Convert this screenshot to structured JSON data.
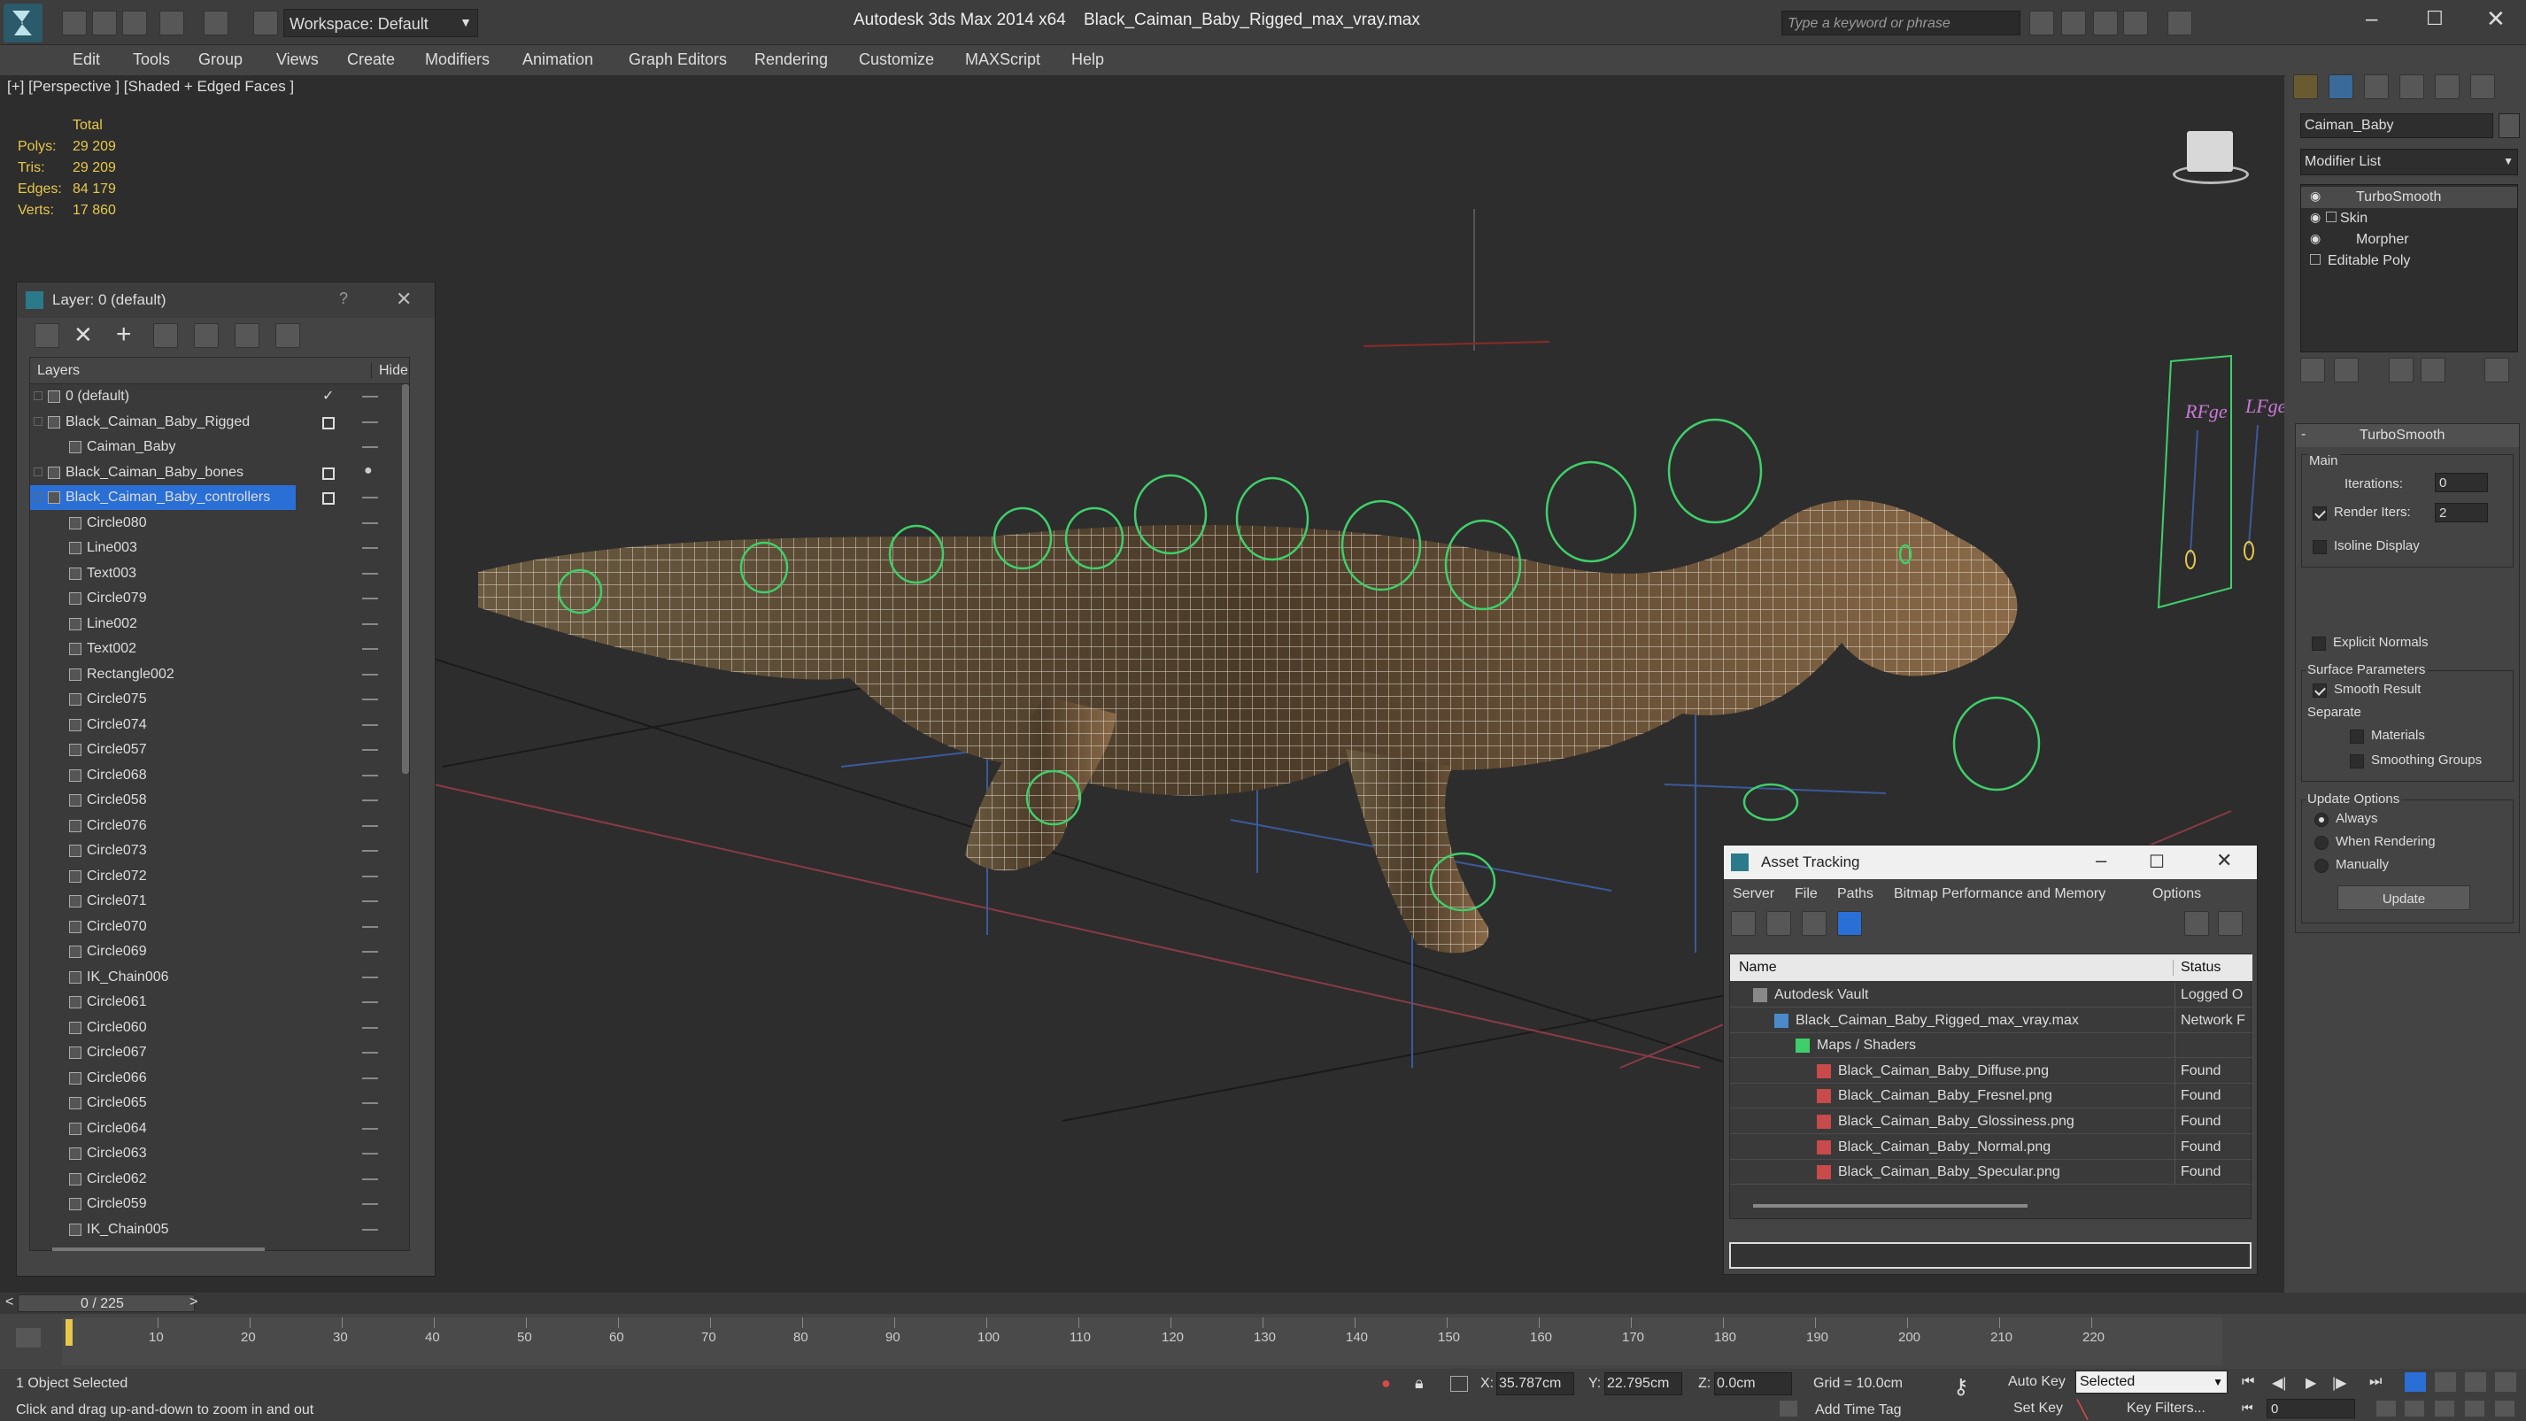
{
  "app": {
    "workspace_label": "Workspace: Default",
    "app_title": "Autodesk 3ds Max  2014 x64",
    "file_title": "Black_Caiman_Baby_Rigged_max_vray.max",
    "search_placeholder": "Type a keyword or phrase"
  },
  "menu": [
    "Edit",
    "Tools",
    "Group",
    "Views",
    "Create",
    "Modifiers",
    "Animation",
    "Graph Editors",
    "Rendering",
    "Customize",
    "MAXScript",
    "Help"
  ],
  "viewport": {
    "label": "[+] [Perspective ] [Shaded + Edged Faces ]",
    "stats": {
      "header": "Total",
      "rows": [
        {
          "label": "Polys:",
          "value": "29 209"
        },
        {
          "label": "Tris:",
          "value": "29 209"
        },
        {
          "label": "Edges:",
          "value": "84 179"
        },
        {
          "label": "Verts:",
          "value": "17 860"
        }
      ]
    },
    "rig_labels": {
      "left": "RFge",
      "right": "LFge"
    }
  },
  "layer_dialog": {
    "title": "Layer: 0 (default)",
    "help": "?",
    "col_layers": "Layers",
    "col_hide": "Hide",
    "rows": [
      {
        "name": "0 (default)",
        "indent": 0,
        "check": true
      },
      {
        "name": "Black_Caiman_Baby_Rigged",
        "indent": 0,
        "box": true
      },
      {
        "name": "Caiman_Baby",
        "indent": 1
      },
      {
        "name": "Black_Caiman_Baby_bones",
        "indent": 0,
        "box": true,
        "bulb": true
      },
      {
        "name": "Black_Caiman_Baby_controllers",
        "indent": 0,
        "box": true,
        "selected": true
      },
      {
        "name": "Circle080",
        "indent": 1
      },
      {
        "name": "Line003",
        "indent": 1
      },
      {
        "name": "Text003",
        "indent": 1
      },
      {
        "name": "Circle079",
        "indent": 1
      },
      {
        "name": "Line002",
        "indent": 1
      },
      {
        "name": "Text002",
        "indent": 1
      },
      {
        "name": "Rectangle002",
        "indent": 1
      },
      {
        "name": "Circle075",
        "indent": 1
      },
      {
        "name": "Circle074",
        "indent": 1
      },
      {
        "name": "Circle057",
        "indent": 1
      },
      {
        "name": "Circle068",
        "indent": 1
      },
      {
        "name": "Circle058",
        "indent": 1
      },
      {
        "name": "Circle076",
        "indent": 1
      },
      {
        "name": "Circle073",
        "indent": 1
      },
      {
        "name": "Circle072",
        "indent": 1
      },
      {
        "name": "Circle071",
        "indent": 1
      },
      {
        "name": "Circle070",
        "indent": 1
      },
      {
        "name": "Circle069",
        "indent": 1
      },
      {
        "name": "IK_Chain006",
        "indent": 1
      },
      {
        "name": "Circle061",
        "indent": 1
      },
      {
        "name": "Circle060",
        "indent": 1
      },
      {
        "name": "Circle067",
        "indent": 1
      },
      {
        "name": "Circle066",
        "indent": 1
      },
      {
        "name": "Circle065",
        "indent": 1
      },
      {
        "name": "Circle064",
        "indent": 1
      },
      {
        "name": "Circle063",
        "indent": 1
      },
      {
        "name": "Circle062",
        "indent": 1
      },
      {
        "name": "Circle059",
        "indent": 1
      },
      {
        "name": "IK_Chain005",
        "indent": 1
      }
    ]
  },
  "asset_tracking": {
    "title": "Asset Tracking",
    "menu": [
      "Server",
      "File",
      "Paths",
      "Bitmap Performance and Memory",
      "Options"
    ],
    "col_name": "Name",
    "col_status": "Status",
    "rows": [
      {
        "name": "Autodesk Vault",
        "status": "Logged O",
        "indent": 0,
        "icon": "vault"
      },
      {
        "name": "Black_Caiman_Baby_Rigged_max_vray.max",
        "status": "Network F",
        "indent": 1,
        "icon": "max"
      },
      {
        "name": "Maps / Shaders",
        "status": "",
        "indent": 2,
        "icon": "folder"
      },
      {
        "name": "Black_Caiman_Baby_Diffuse.png",
        "status": "Found",
        "indent": 3,
        "icon": "png"
      },
      {
        "name": "Black_Caiman_Baby_Fresnel.png",
        "status": "Found",
        "indent": 3,
        "icon": "png"
      },
      {
        "name": "Black_Caiman_Baby_Glossiness.png",
        "status": "Found",
        "indent": 3,
        "icon": "png"
      },
      {
        "name": "Black_Caiman_Baby_Normal.png",
        "status": "Found",
        "indent": 3,
        "icon": "png"
      },
      {
        "name": "Black_Caiman_Baby_Specular.png",
        "status": "Found",
        "indent": 3,
        "icon": "png"
      }
    ]
  },
  "command_panel": {
    "object_name": "Caiman_Baby",
    "modifier_list": "Modifier List",
    "stack": [
      "TurboSmooth",
      "Skin",
      "Morpher",
      "Editable Poly"
    ],
    "rollout_title": "TurboSmooth",
    "main_label": "Main",
    "iterations_label": "Iterations:",
    "iterations_value": "0",
    "render_iters_label": "Render Iters:",
    "render_iters_value": "2",
    "isoline": "Isoline Display",
    "explicit_normals": "Explicit Normals",
    "surface_params": "Surface Parameters",
    "smooth_result": "Smooth Result",
    "separate": "Separate",
    "materials": "Materials",
    "smoothing_groups": "Smoothing Groups",
    "update_options": "Update Options",
    "always": "Always",
    "when_rendering": "When Rendering",
    "manually": "Manually",
    "update_btn": "Update"
  },
  "timeline": {
    "frame_label": "0 / 225",
    "ticks": [
      "10",
      "20",
      "30",
      "40",
      "50",
      "60",
      "70",
      "80",
      "90",
      "100",
      "110",
      "120",
      "130",
      "140",
      "150",
      "160",
      "170",
      "180",
      "190",
      "200",
      "210",
      "220"
    ]
  },
  "status": {
    "selected": "1 Object Selected",
    "prompt": "Click and drag up-and-down to zoom in and out",
    "x_label": "X:",
    "x_value": "35.787cm",
    "y_label": "Y:",
    "y_value": "22.795cm",
    "z_label": "Z:",
    "z_value": "0.0cm",
    "grid": "Grid = 10.0cm",
    "add_time_tag": "Add Time Tag",
    "auto_key": "Auto Key",
    "selected_dropdown": "Selected",
    "set_key": "Set Key",
    "key_filters": "Key Filters...",
    "frame_value": "0"
  },
  "colors": {
    "accent_blue": "#2a6fd6",
    "rig_green": "#3fcf6a",
    "stat_yellow": "#e6c84a",
    "viewport_bg": "#2d2d2d"
  }
}
